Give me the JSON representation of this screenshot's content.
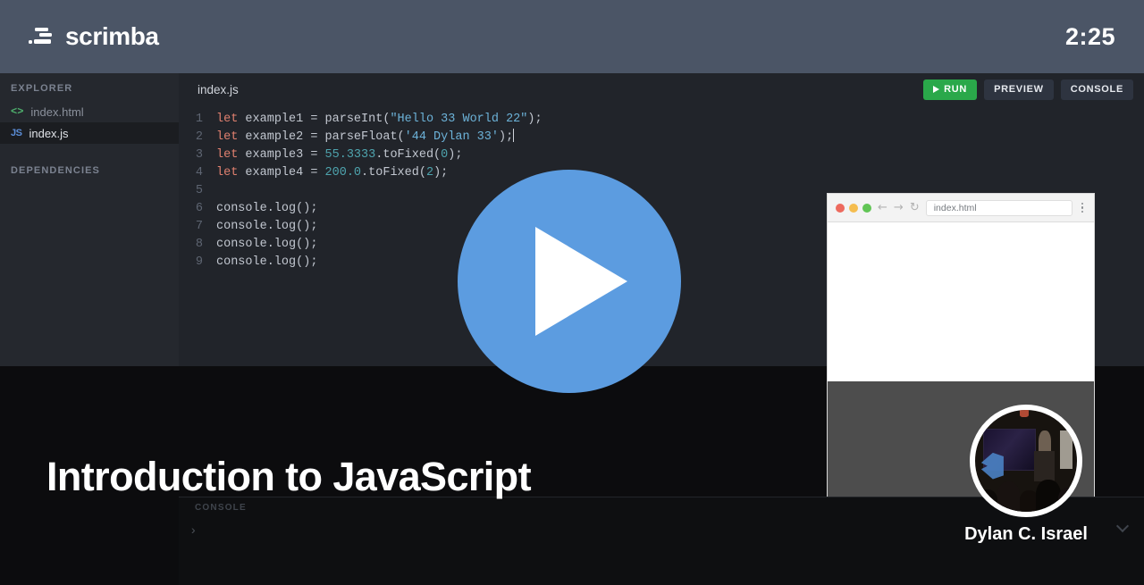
{
  "topbar": {
    "brand_name": "scrimba",
    "logo_icon": "scrimba-speedlines-icon",
    "timer": "2:25"
  },
  "sidebar": {
    "explorer_header": "EXPLORER",
    "dependencies_header": "DEPENDENCIES",
    "files": [
      {
        "label": "index.html",
        "icon": "html-code-icon",
        "icon_glyph": "<>",
        "active": false
      },
      {
        "label": "index.js",
        "icon": "js-file-icon",
        "icon_glyph": "JS",
        "active": true
      }
    ]
  },
  "editor": {
    "tab_label": "index.js",
    "buttons": {
      "run": "RUN",
      "preview": "PREVIEW",
      "console": "CONSOLE"
    },
    "run_color": "#2aa84a",
    "lines": [
      {
        "n": "1",
        "text": "let example1 = parseInt(\"Hello 33 World 22\");"
      },
      {
        "n": "2",
        "text": "let example2 = parseFloat('44 Dylan 33');"
      },
      {
        "n": "3",
        "text": "let example3 = 55.3333.toFixed(0);"
      },
      {
        "n": "4",
        "text": "let example4 = 200.0.toFixed(2);"
      },
      {
        "n": "5",
        "text": ""
      },
      {
        "n": "6",
        "text": "console.log();"
      },
      {
        "n": "7",
        "text": "console.log();"
      },
      {
        "n": "8",
        "text": "console.log();"
      },
      {
        "n": "9",
        "text": "console.log();"
      }
    ]
  },
  "console_panel": {
    "label": "CONSOLE",
    "prompt": "›",
    "collapse_icon": "chevron-down-icon"
  },
  "browser_preview": {
    "url": "index.html",
    "traffic_lights": [
      "#ed6a5e",
      "#f5bd4f",
      "#61c555"
    ],
    "back_icon": "←",
    "forward_icon": "→",
    "reload_icon": "↻",
    "menu_icon": "kebab-menu-icon"
  },
  "video_overlay": {
    "title": "Introduction to JavaScript",
    "presenter": "Dylan C. Israel",
    "play_icon": "play-button-icon",
    "play_color": "#5c9ce0"
  }
}
